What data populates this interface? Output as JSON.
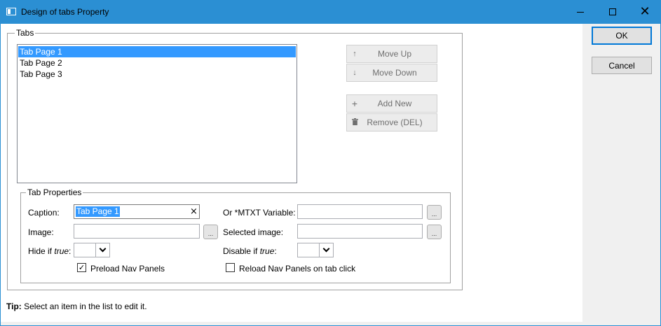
{
  "window": {
    "title": "Design of tabs Property"
  },
  "tabs_group": {
    "label": "Tabs",
    "items": [
      {
        "label": "Tab Page 1",
        "selected": true
      },
      {
        "label": "Tab Page 2",
        "selected": false
      },
      {
        "label": "Tab Page 3",
        "selected": false
      }
    ]
  },
  "actions": {
    "move_up": "Move Up",
    "move_down": "Move Down",
    "add_new": "Add New",
    "remove": "Remove (DEL)"
  },
  "dialog": {
    "ok": "OK",
    "cancel": "Cancel"
  },
  "tab_properties": {
    "label": "Tab Properties",
    "caption_label": "Caption:",
    "caption_value": "Tab Page 1",
    "mtxt_label": "Or *MTXT Variable:",
    "mtxt_value": "",
    "image_label": "Image:",
    "image_value": "",
    "selected_image_label": "Selected image:",
    "selected_image_value": "",
    "hide_if_prefix": "Hide if ",
    "hide_if_italic": "true",
    "hide_if_suffix": ":",
    "disable_if_prefix": "Disable if ",
    "disable_if_italic": "true",
    "disable_if_suffix": ":",
    "browse_glyph": "...",
    "clear_glyph": "×",
    "preload_label": "Preload Nav Panels",
    "preload_checked": true,
    "reload_label": "Reload Nav Panels on tab click",
    "reload_checked": false
  },
  "tip": {
    "bold": "Tip:",
    "text": " Select an item in the list to edit it."
  },
  "colors": {
    "titlebar": "#2b8fd3",
    "selection": "#3399ff",
    "default_button_border": "#0078d7"
  },
  "icons": {
    "move_up": "arrow-up-icon",
    "move_down": "arrow-down-icon",
    "add_new": "plus-icon",
    "remove": "trash-icon"
  }
}
